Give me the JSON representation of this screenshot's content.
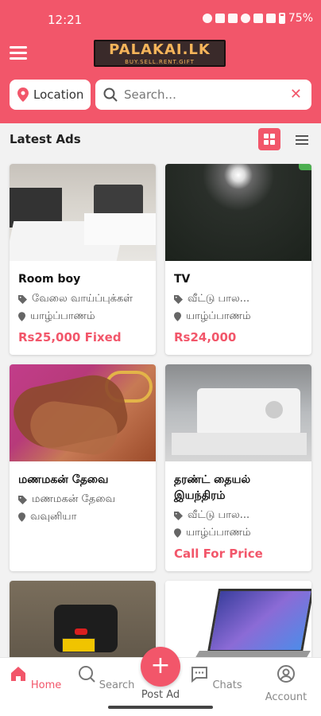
{
  "status_bar": {
    "time": "12:21",
    "battery": "75%"
  },
  "header": {
    "logo_main": "PALAKAI.LK",
    "logo_sub": "BUY.SELL.RENT.GIFT",
    "location_label": "Location",
    "search_placeholder": "Search...",
    "clear_glyph": "✕"
  },
  "section": {
    "title": "Latest Ads"
  },
  "ads": [
    {
      "title": "Room boy",
      "category": "வேலை வாய்ப்புக்கள்",
      "location": "யாழ்ப்பாணம்",
      "price": "Rs25,000 Fixed"
    },
    {
      "title": "TV",
      "category": "வீட்டு பால...",
      "location": "யாழ்ப்பாணம்",
      "price": "Rs24,000"
    },
    {
      "title": "மணமகன் தேவை",
      "category": "மணமகன் தேவை",
      "location": "வவுனியா",
      "price": ""
    },
    {
      "title": "தரண்ட் தையல் இயந்திரம்",
      "category": "வீட்டு பால...",
      "location": "யாழ்ப்பாணம்",
      "price": "Call For Price"
    }
  ],
  "nav": {
    "home": "Home",
    "search": "Search",
    "post_ad": "Post Ad",
    "chats": "Chats",
    "account": "Account"
  },
  "colors": {
    "brand": "#f2566a",
    "logo_bg": "#3a2a2a",
    "logo_text": "#f5b45a"
  }
}
